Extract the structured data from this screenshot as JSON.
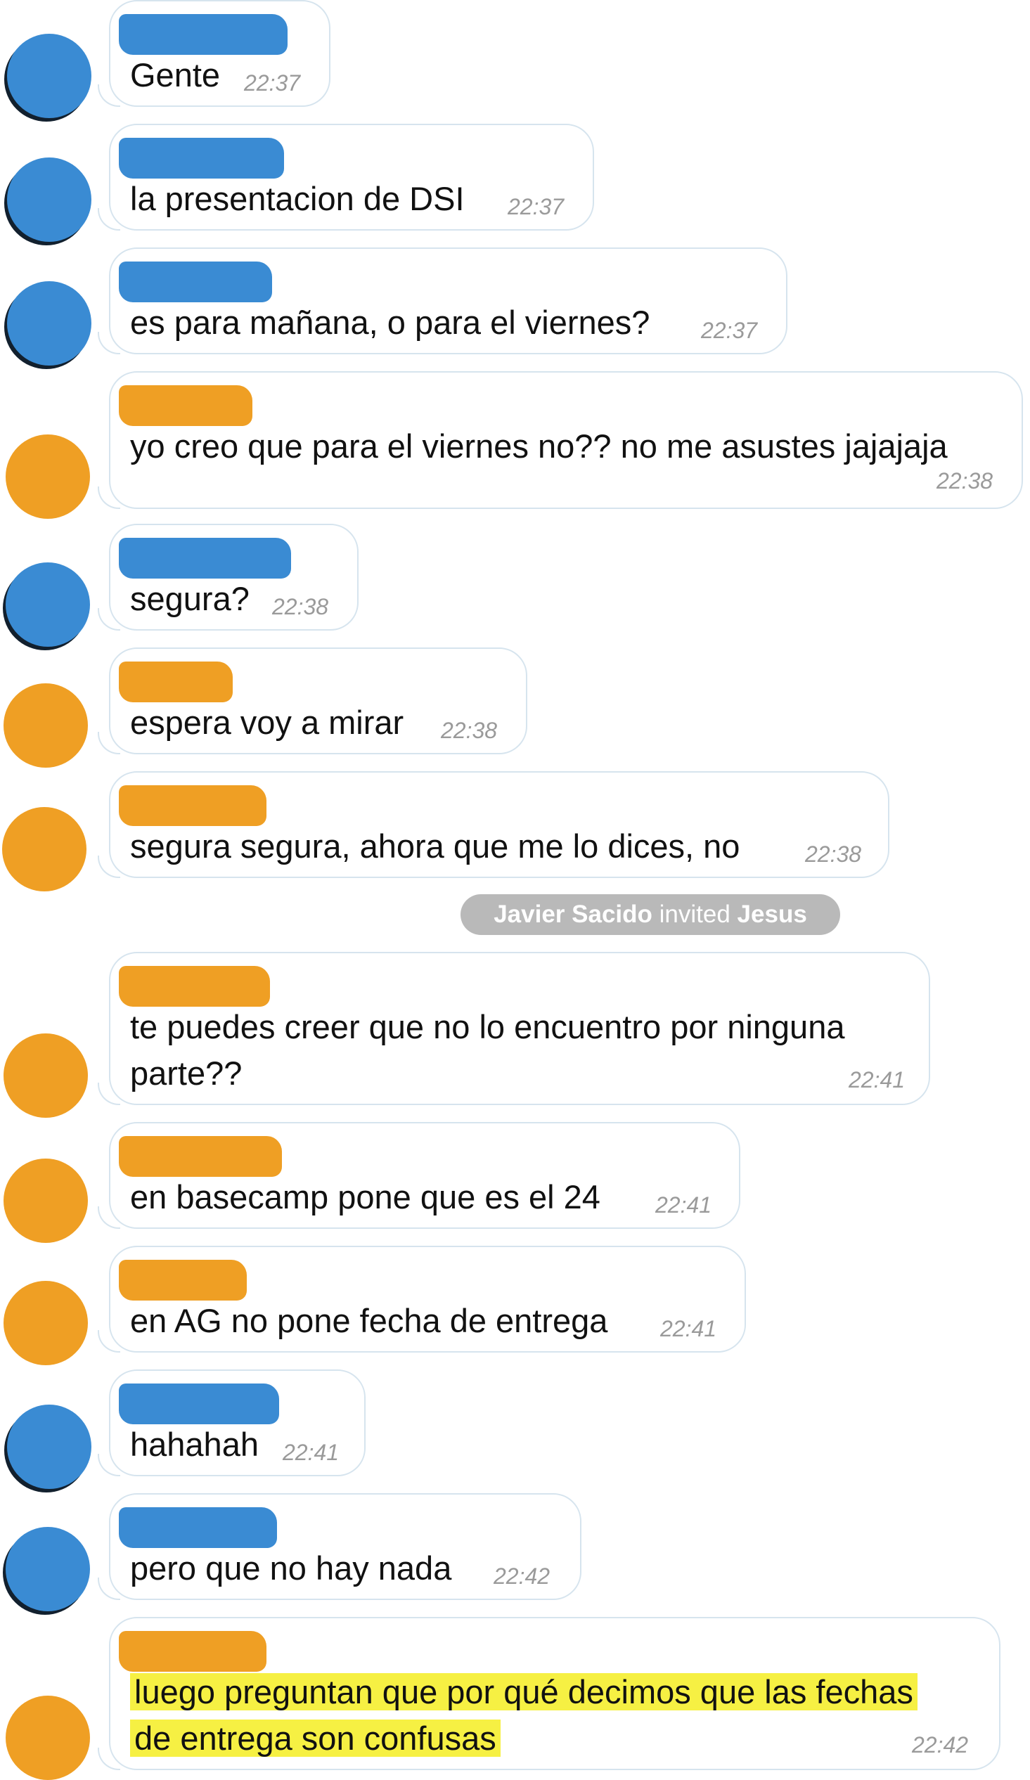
{
  "colors": {
    "avatar_blue": "#3a8bd3",
    "avatar_orange": "#ef9f24",
    "bubble_border": "#d6e4ee",
    "timestamp": "#9a9a9a",
    "highlight": "#f6f043",
    "service_bg": "#b9b9b9"
  },
  "messages": [
    {
      "text": "Gente",
      "time": "22:37",
      "avatar_color": "blue"
    },
    {
      "text": "la presentacion de DSI",
      "time": "22:37",
      "avatar_color": "blue"
    },
    {
      "text": "es para mañana, o para el viernes?",
      "time": "22:37",
      "avatar_color": "blue"
    },
    {
      "text": "yo creo que para el viernes no?? no me asustes jajajaja",
      "time": "22:38",
      "avatar_color": "orange"
    },
    {
      "text": "segura?",
      "time": "22:38",
      "avatar_color": "blue"
    },
    {
      "text": "espera voy a mirar",
      "time": "22:38",
      "avatar_color": "orange"
    },
    {
      "text": "segura segura, ahora que me lo dices, no",
      "time": "22:38",
      "avatar_color": "orange"
    },
    {
      "text_line1": "te puedes creer que no lo encuentro por ninguna",
      "text_line2": "parte??",
      "time": "22:41",
      "avatar_color": "orange"
    },
    {
      "text": "en basecamp pone que es el 24",
      "time": "22:41",
      "avatar_color": "orange"
    },
    {
      "text": "en AG no pone fecha de entrega",
      "time": "22:41",
      "avatar_color": "orange"
    },
    {
      "text": "hahahah",
      "time": "22:41",
      "avatar_color": "blue"
    },
    {
      "text": "pero que no hay nada",
      "time": "22:42",
      "avatar_color": "blue"
    },
    {
      "text_line1": "luego preguntan que por qué decimos que las fechas",
      "text_line2": "de entrega son confusas",
      "time": "22:42",
      "avatar_color": "orange",
      "highlighted": true
    }
  ],
  "service_message": {
    "actor": "Javier Sacido",
    "action": "invited",
    "target": "Jesus"
  }
}
